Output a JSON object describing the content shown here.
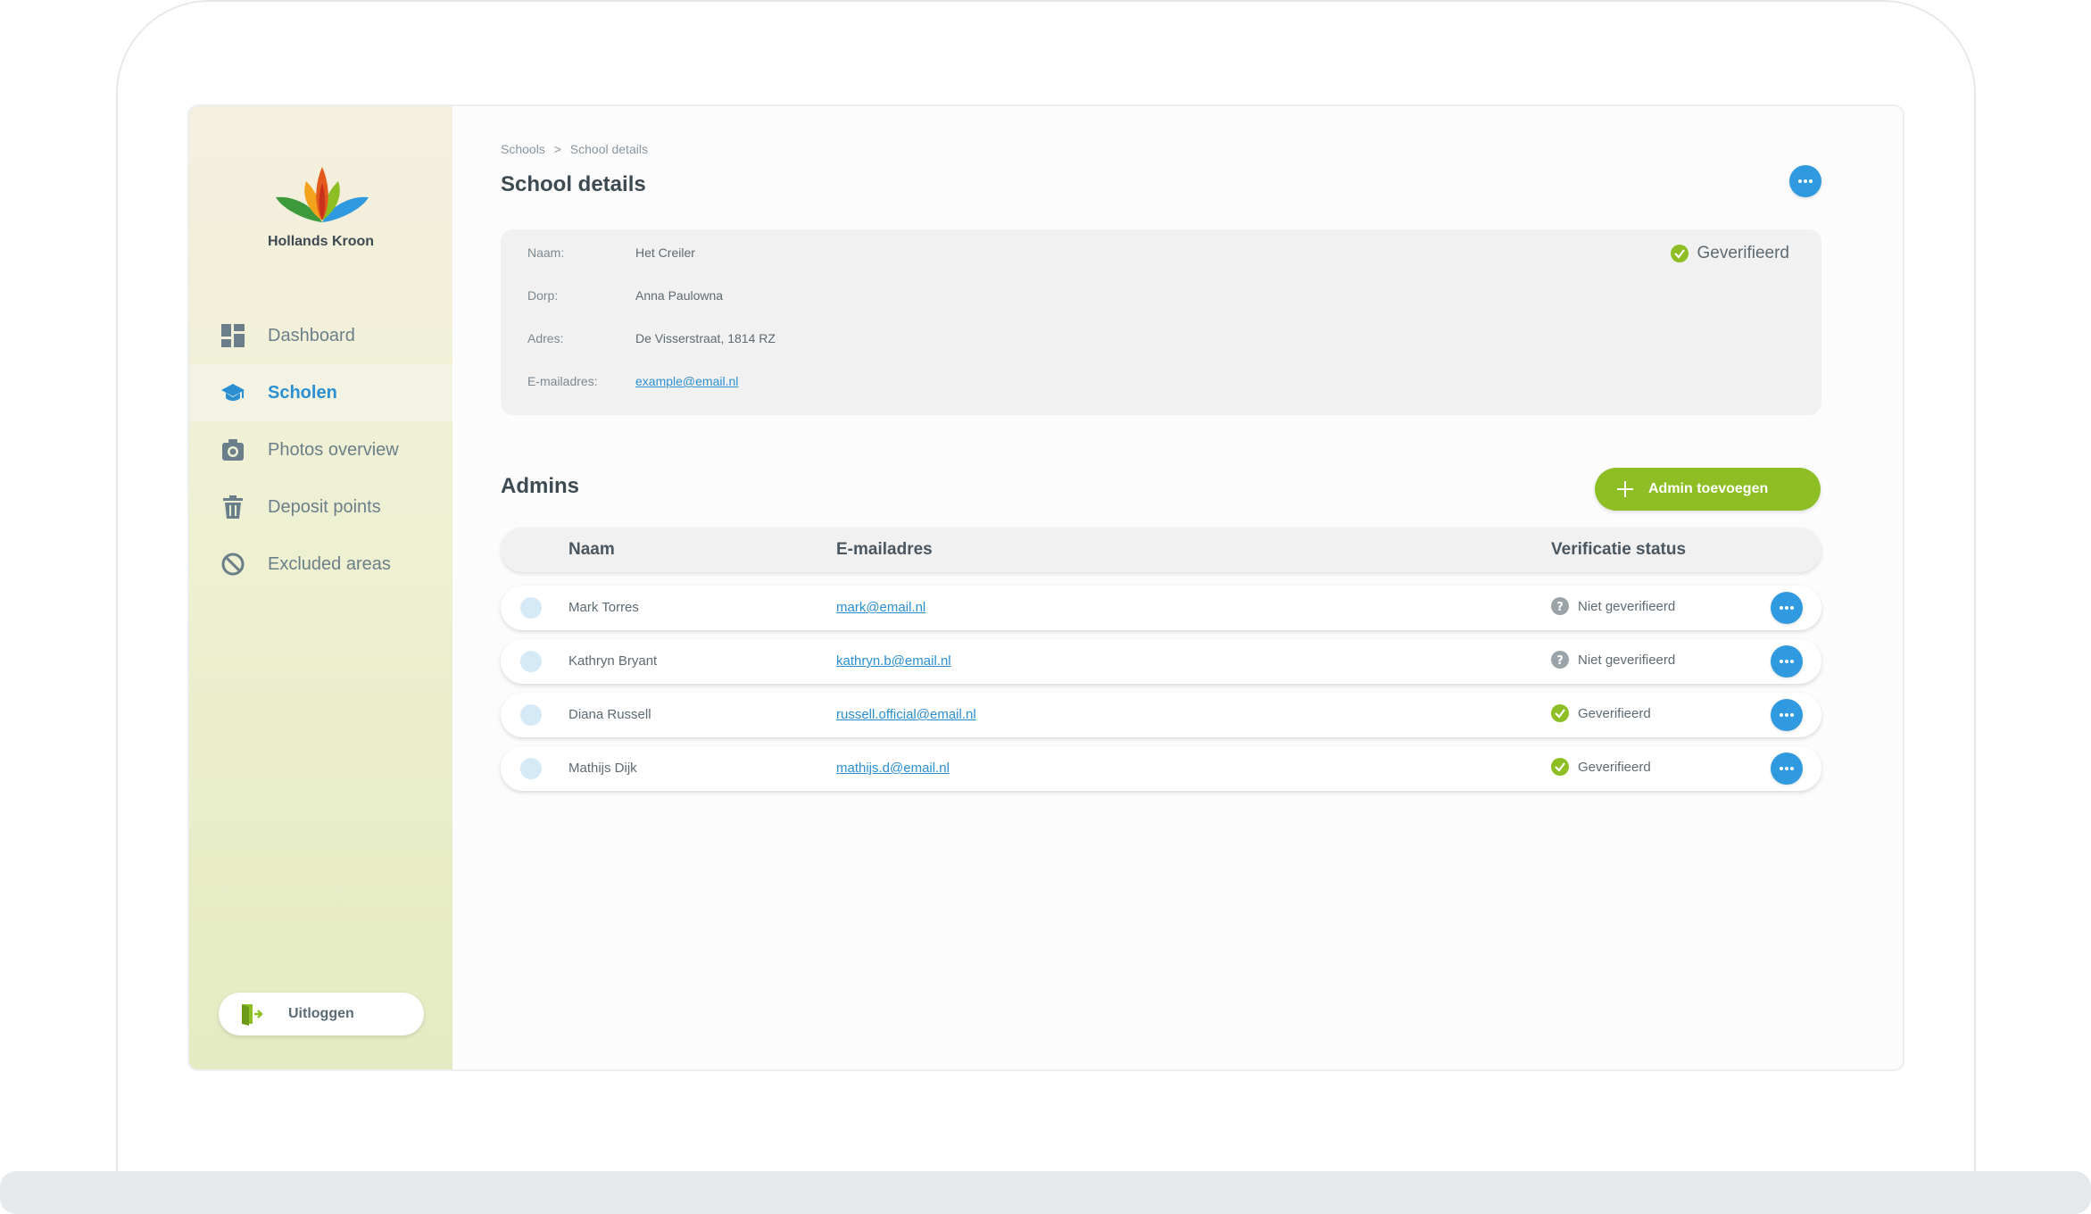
{
  "brand": {
    "name": "Hollands Kroon"
  },
  "sidebar": {
    "items": [
      {
        "label": "Dashboard",
        "icon": "dashboard-icon"
      },
      {
        "label": "Scholen",
        "icon": "graduation-cap-icon",
        "active": true
      },
      {
        "label": "Photos overview",
        "icon": "camera-icon"
      },
      {
        "label": "Deposit points",
        "icon": "trash-icon"
      },
      {
        "label": "Excluded areas",
        "icon": "block-icon"
      }
    ],
    "logout_label": "Uitloggen"
  },
  "breadcrumb": {
    "parent": "Schools",
    "separator": ">",
    "current": "School details"
  },
  "page_title": "School details",
  "details": {
    "name_label": "Naam:",
    "name_value": "Het Creiler",
    "village_label": "Dorp:",
    "village_value": "Anna Paulowna",
    "address_label": "Adres:",
    "address_value": "De Visserstraat, 1814 RZ",
    "email_label": "E-mailadres:",
    "email_value": "example@email.nl",
    "status": "Geverifieerd"
  },
  "admins": {
    "title": "Admins",
    "add_button_label": "Admin toevoegen",
    "columns": {
      "name": "Naam",
      "email": "E-mailadres",
      "status": "Verificatie status"
    },
    "rows": [
      {
        "name": "Mark Torres",
        "email": "mark@email.nl",
        "status": "Niet geverifieerd",
        "verified": false
      },
      {
        "name": "Kathryn Bryant",
        "email": "kathryn.b@email.nl",
        "status": "Niet geverifieerd",
        "verified": false
      },
      {
        "name": "Diana Russell",
        "email": "russell.official@email.nl",
        "status": "Geverifieerd",
        "verified": true
      },
      {
        "name": "Mathijs Dijk",
        "email": "mathijs.d@email.nl",
        "status": "Geverifieerd",
        "verified": true
      }
    ]
  },
  "colors": {
    "accent_blue": "#2f9ae0",
    "accent_green": "#8dbe24",
    "unverified_gray": "#9aa3a8"
  }
}
